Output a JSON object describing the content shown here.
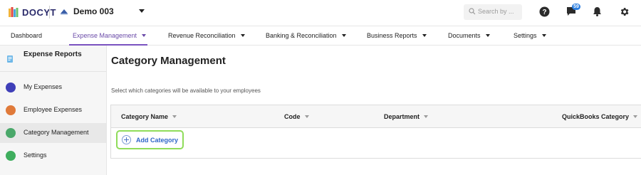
{
  "app": {
    "logo_text": "DOCYT",
    "business_name": "Demo 003"
  },
  "header": {
    "search_placeholder": "Search by ...",
    "notification_badge": "59",
    "icons": [
      "search-icon",
      "help-icon",
      "chat-icon",
      "bell-icon",
      "gear-icon"
    ]
  },
  "nav": {
    "items": [
      {
        "label": "Dashboard",
        "has_caret": false
      },
      {
        "label": "Expense Management",
        "has_caret": true,
        "active": true
      },
      {
        "label": "Revenue Reconciliation",
        "has_caret": true
      },
      {
        "label": "Banking & Reconciliation",
        "has_caret": true
      },
      {
        "label": "Business Reports",
        "has_caret": true
      },
      {
        "label": "Documents",
        "has_caret": true
      },
      {
        "label": "Settings",
        "has_caret": true
      }
    ]
  },
  "sidebar": {
    "title": "Expense Reports",
    "items": [
      {
        "label": "My Expenses",
        "icon": "gear-icon",
        "color": "#3f3fb8"
      },
      {
        "label": "Employee Expenses",
        "icon": "receipt-icon",
        "color": "#e07a3a"
      },
      {
        "label": "Category Management",
        "icon": "category-icon",
        "color": "#4aa86a",
        "active": true
      },
      {
        "label": "Settings",
        "icon": "gear-icon",
        "color": "#3fae5e"
      }
    ]
  },
  "main": {
    "title": "Category Management",
    "description": "Select which categories will be available to your employees",
    "table": {
      "columns": [
        "Category Name",
        "Code",
        "Department",
        "QuickBooks Category"
      ]
    },
    "add_button_label": "Add Category"
  },
  "colors": {
    "accent_purple": "#7a52c0",
    "link_blue": "#2f66c8",
    "highlight_green": "#8fdc5a",
    "badge_blue": "#2d7fe0"
  }
}
